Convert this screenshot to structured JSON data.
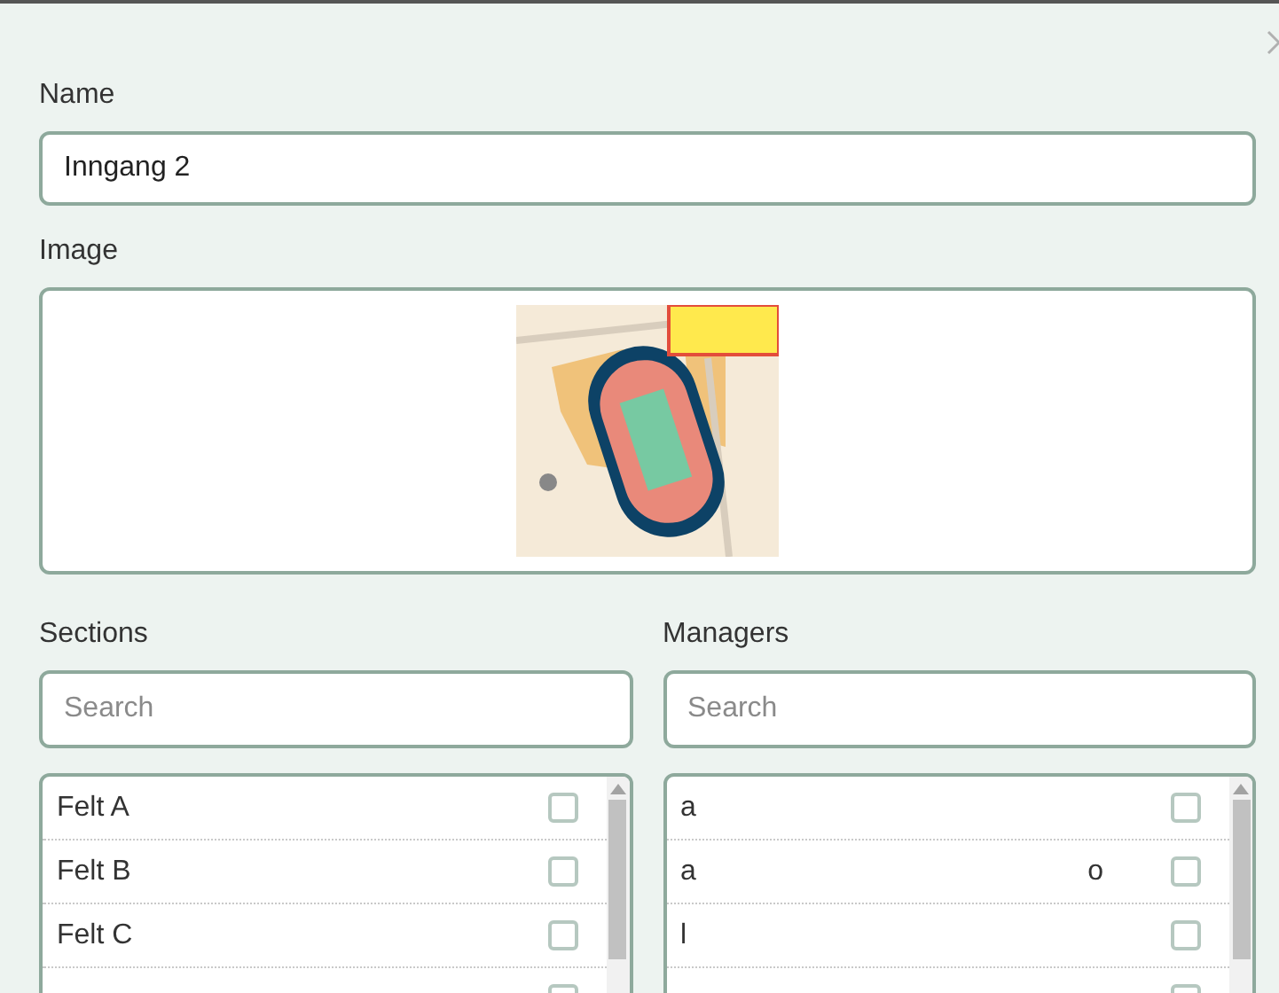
{
  "name_field": {
    "label": "Name",
    "value": "Inngang 2"
  },
  "image_field": {
    "label": "Image"
  },
  "sections": {
    "label": "Sections",
    "search": {
      "placeholder": "Search"
    },
    "items": [
      {
        "label": "Felt A",
        "checked": false
      },
      {
        "label": "Felt B",
        "checked": false
      },
      {
        "label": "Felt C",
        "checked": false
      },
      {
        "checked": false
      }
    ]
  },
  "managers": {
    "label": "Managers",
    "search": {
      "placeholder": "Search"
    },
    "items": [
      {
        "label": "a",
        "checked": false
      },
      {
        "label": "a",
        "trailing": "o",
        "checked": false
      },
      {
        "label": "l",
        "checked": false
      },
      {
        "checked": false
      }
    ]
  }
}
